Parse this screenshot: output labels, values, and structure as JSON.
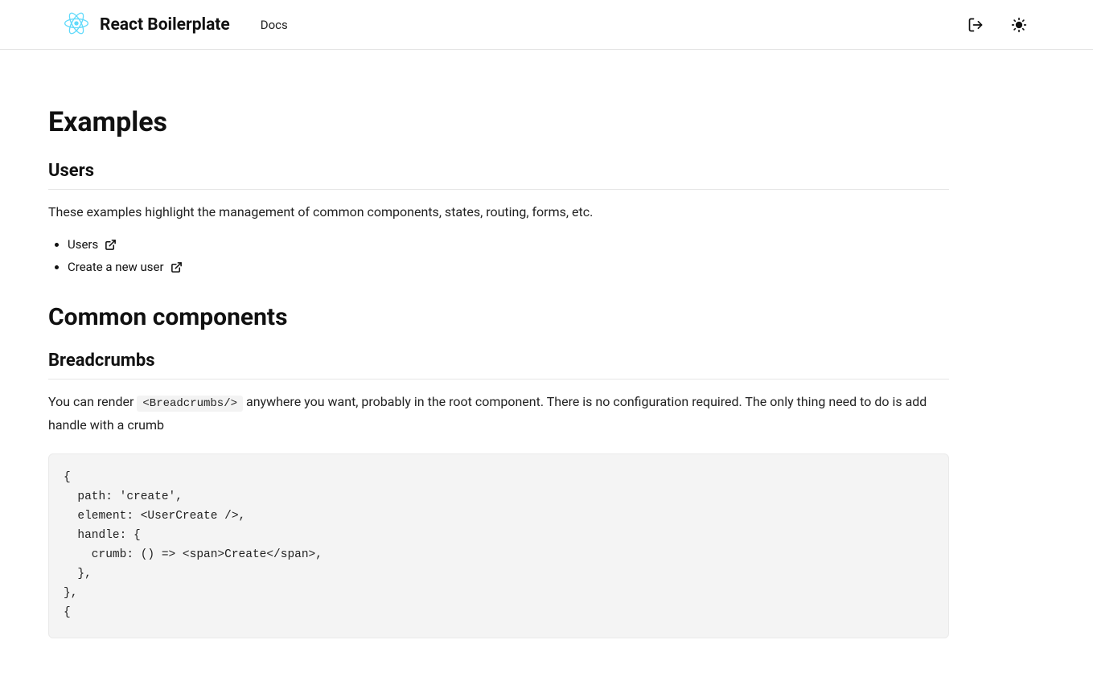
{
  "header": {
    "brand": "React Boilerplate",
    "nav": {
      "docs": "Docs"
    }
  },
  "page": {
    "title": "Examples",
    "users": {
      "heading": "Users",
      "intro": "These examples highlight the management of common components, states, routing, forms, etc.",
      "links": [
        {
          "label": "Users"
        },
        {
          "label": "Create a new user"
        }
      ]
    },
    "common": {
      "heading": "Common components",
      "breadcrumbs": {
        "heading": "Breadcrumbs",
        "text_before": "You can render ",
        "inline_code": "<Breadcrumbs/>",
        "text_after": " anywhere you want, probably in the root component. There is no configuration required. The only thing need to do is add handle with a crumb",
        "code": "{\n  path: 'create',\n  element: <UserCreate />,\n  handle: {\n    crumb: () => <span>Create</span>,\n  },\n},\n{"
      }
    }
  }
}
